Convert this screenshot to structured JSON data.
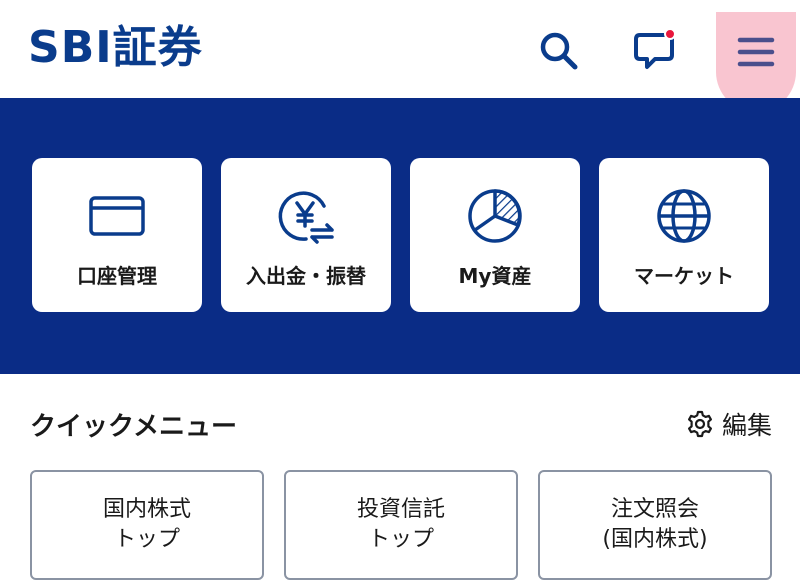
{
  "header": {
    "logo_text": "SBI証券",
    "search_icon": "search-icon",
    "message_icon": "chat-bubble-icon",
    "menu_icon": "hamburger-menu-icon",
    "brand_color": "#0a3c8c",
    "notification_color": "#e8173c"
  },
  "main_nav": {
    "band_color": "#0a2c86",
    "tiles": [
      {
        "label": "口座管理",
        "icon": "credit-card-icon"
      },
      {
        "label": "入出金・振替",
        "icon": "yen-transfer-icon"
      },
      {
        "label": "My資産",
        "icon": "pie-chart-icon"
      },
      {
        "label": "マーケット",
        "icon": "globe-icon"
      }
    ]
  },
  "quick_menu": {
    "title": "クイックメニュー",
    "edit_label": "編集",
    "edit_icon": "gear-icon",
    "items": [
      {
        "line1": "国内株式",
        "line2": "トップ"
      },
      {
        "line1": "投資信託",
        "line2": "トップ"
      },
      {
        "line1": "注文照会",
        "line2": "(国内株式)"
      }
    ]
  }
}
